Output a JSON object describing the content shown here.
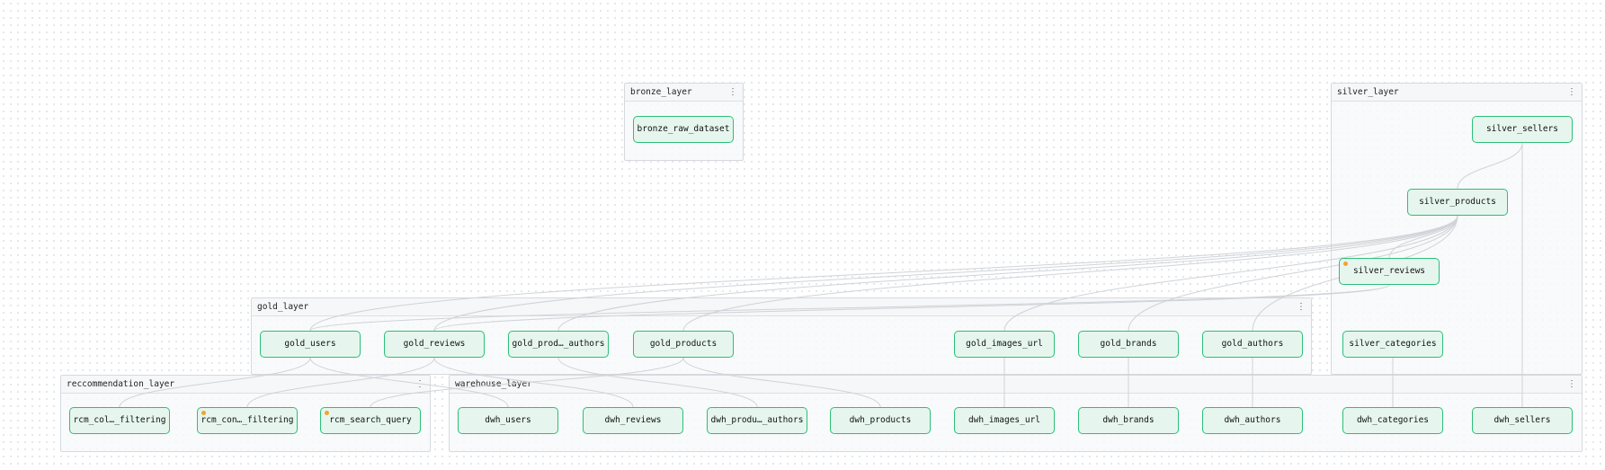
{
  "groups": [
    {
      "id": "bronze_layer",
      "title": "bronze_layer",
      "menu_icon": "⋮"
    },
    {
      "id": "silver_layer",
      "title": "silver_layer",
      "menu_icon": "⋮"
    },
    {
      "id": "gold_layer",
      "title": "gold_layer",
      "menu_icon": "⋮"
    },
    {
      "id": "reccommendation_layer",
      "title": "reccommendation_layer",
      "menu_icon": "⋮"
    },
    {
      "id": "warehouse_layer",
      "title": "warehouse_layer",
      "menu_icon": "⋮"
    }
  ],
  "nodes": [
    {
      "id": "bronze_raw_dataset",
      "label": "bronze_raw_dataset",
      "marker": false
    },
    {
      "id": "silver_sellers",
      "label": "silver_sellers",
      "marker": false
    },
    {
      "id": "silver_products",
      "label": "silver_products",
      "marker": false
    },
    {
      "id": "silver_reviews",
      "label": "silver_reviews",
      "marker": true
    },
    {
      "id": "silver_categories",
      "label": "silver_categories",
      "marker": false
    },
    {
      "id": "gold_users",
      "label": "gold_users",
      "marker": false
    },
    {
      "id": "gold_reviews",
      "label": "gold_reviews",
      "marker": false
    },
    {
      "id": "gold_prod_authors",
      "label": "gold_prod…_authors",
      "marker": false
    },
    {
      "id": "gold_products",
      "label": "gold_products",
      "marker": false
    },
    {
      "id": "gold_images_url",
      "label": "gold_images_url",
      "marker": false
    },
    {
      "id": "gold_brands",
      "label": "gold_brands",
      "marker": false
    },
    {
      "id": "gold_authors",
      "label": "gold_authors",
      "marker": false
    },
    {
      "id": "rcm_col_filtering",
      "label": "rcm_col…_filtering",
      "marker": false
    },
    {
      "id": "rcm_con_filtering",
      "label": "rcm_con…_filtering",
      "marker": true
    },
    {
      "id": "rcm_search_query",
      "label": "rcm_search_query",
      "marker": true
    },
    {
      "id": "dwh_users",
      "label": "dwh_users",
      "marker": false
    },
    {
      "id": "dwh_reviews",
      "label": "dwh_reviews",
      "marker": false
    },
    {
      "id": "dwh_produ_authors",
      "label": "dwh_produ…_authors",
      "marker": false
    },
    {
      "id": "dwh_products",
      "label": "dwh_products",
      "marker": false
    },
    {
      "id": "dwh_images_url",
      "label": "dwh_images_url",
      "marker": false
    },
    {
      "id": "dwh_brands",
      "label": "dwh_brands",
      "marker": false
    },
    {
      "id": "dwh_authors",
      "label": "dwh_authors",
      "marker": false
    },
    {
      "id": "dwh_categories",
      "label": "dwh_categories",
      "marker": false
    },
    {
      "id": "dwh_sellers",
      "label": "dwh_sellers",
      "marker": false
    }
  ],
  "edges": [
    [
      "silver_sellers",
      "silver_products"
    ],
    [
      "silver_sellers",
      "dwh_sellers"
    ],
    [
      "silver_products",
      "silver_reviews"
    ],
    [
      "silver_products",
      "gold_users"
    ],
    [
      "silver_products",
      "gold_reviews"
    ],
    [
      "silver_products",
      "gold_prod_authors"
    ],
    [
      "silver_products",
      "gold_products"
    ],
    [
      "silver_products",
      "gold_images_url"
    ],
    [
      "silver_products",
      "gold_brands"
    ],
    [
      "silver_products",
      "gold_authors"
    ],
    [
      "silver_reviews",
      "gold_users"
    ],
    [
      "silver_reviews",
      "gold_reviews"
    ],
    [
      "silver_categories",
      "dwh_categories"
    ],
    [
      "gold_users",
      "dwh_users"
    ],
    [
      "gold_reviews",
      "dwh_reviews"
    ],
    [
      "gold_prod_authors",
      "dwh_produ_authors"
    ],
    [
      "gold_products",
      "dwh_products"
    ],
    [
      "gold_images_url",
      "dwh_images_url"
    ],
    [
      "gold_brands",
      "dwh_brands"
    ],
    [
      "gold_authors",
      "dwh_authors"
    ],
    [
      "gold_users",
      "rcm_col_filtering"
    ],
    [
      "gold_reviews",
      "rcm_con_filtering"
    ],
    [
      "gold_products",
      "rcm_search_query"
    ]
  ],
  "colors": {
    "node_border": "#2bbf77",
    "node_fill": "#e6f6ee",
    "marker": "#f0a52c",
    "edge": "#cfd3d8",
    "group_border": "#d6d9de"
  }
}
